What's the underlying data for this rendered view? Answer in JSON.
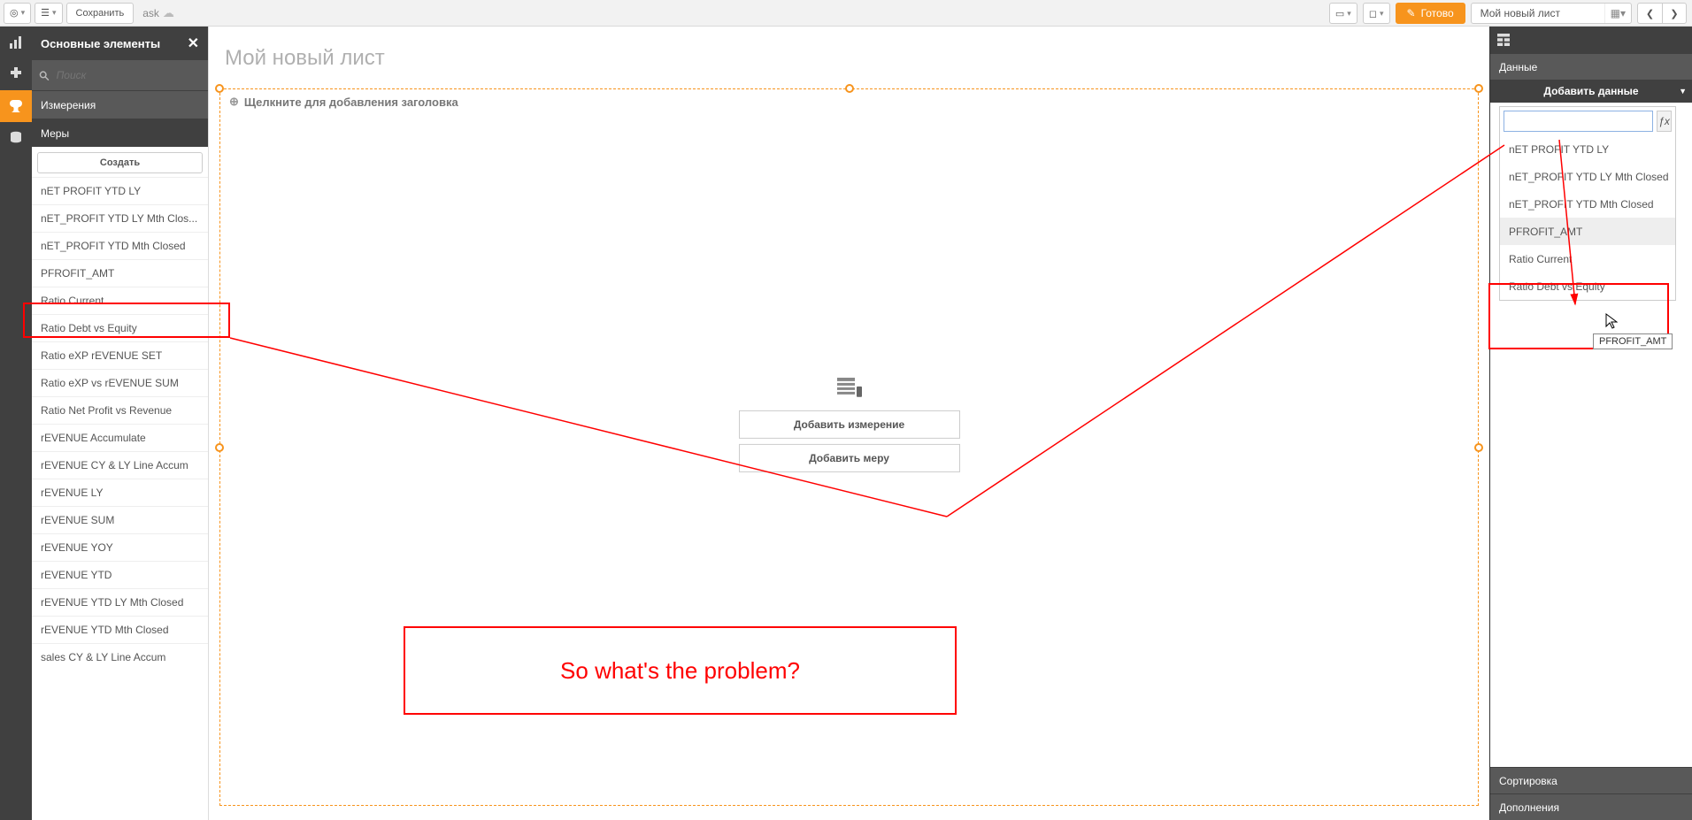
{
  "toolbar": {
    "save_label": "Сохранить",
    "app_name": "ask",
    "done_label": "Готово"
  },
  "sheet_nav": {
    "sheet_name": "Мой новый лист"
  },
  "left_panel": {
    "title": "Основные элементы",
    "search_placeholder": "Поиск",
    "dimensions_label": "Измерения",
    "measures_label": "Меры",
    "create_label": "Создать",
    "measures": [
      "nET PROFIT YTD LY",
      "nET_PROFIT YTD LY Mth Clos...",
      "nET_PROFIT YTD Mth Closed",
      "PFROFIT_AMT",
      "Ratio Current",
      "Ratio Debt vs Equity",
      "Ratio eXP rEVENUE SET",
      "Ratio eXP vs rEVENUE SUM",
      "Ratio Net Profit vs Revenue",
      "rEVENUE Accumulate",
      "rEVENUE CY & LY Line Accum",
      "rEVENUE LY",
      "rEVENUE SUM",
      "rEVENUE YOY",
      "rEVENUE YTD",
      "rEVENUE YTD LY Mth Closed",
      "rEVENUE YTD Mth Closed",
      "sales CY & LY Line Accum"
    ]
  },
  "canvas": {
    "sheet_title": "Мой новый лист",
    "add_title_hint": "Щелкните для добавления заголовка",
    "add_dimension_label": "Добавить измерение",
    "add_measure_label": "Добавить меру"
  },
  "right_panel": {
    "data_label": "Данные",
    "add_data_label": "Добавить данные",
    "sort_label": "Сортировка",
    "addons_label": "Дополнения",
    "picker_items": [
      "nET PROFIT YTD LY",
      "nET_PROFIT YTD LY Mth Closed",
      "nET_PROFIT YTD Mth Closed",
      "PFROFIT_AMT",
      "Ratio Current",
      "Ratio Debt vs Equity"
    ],
    "tooltip": "PFROFIT_AMT"
  },
  "annotation": {
    "question": "So what's the problem?"
  }
}
